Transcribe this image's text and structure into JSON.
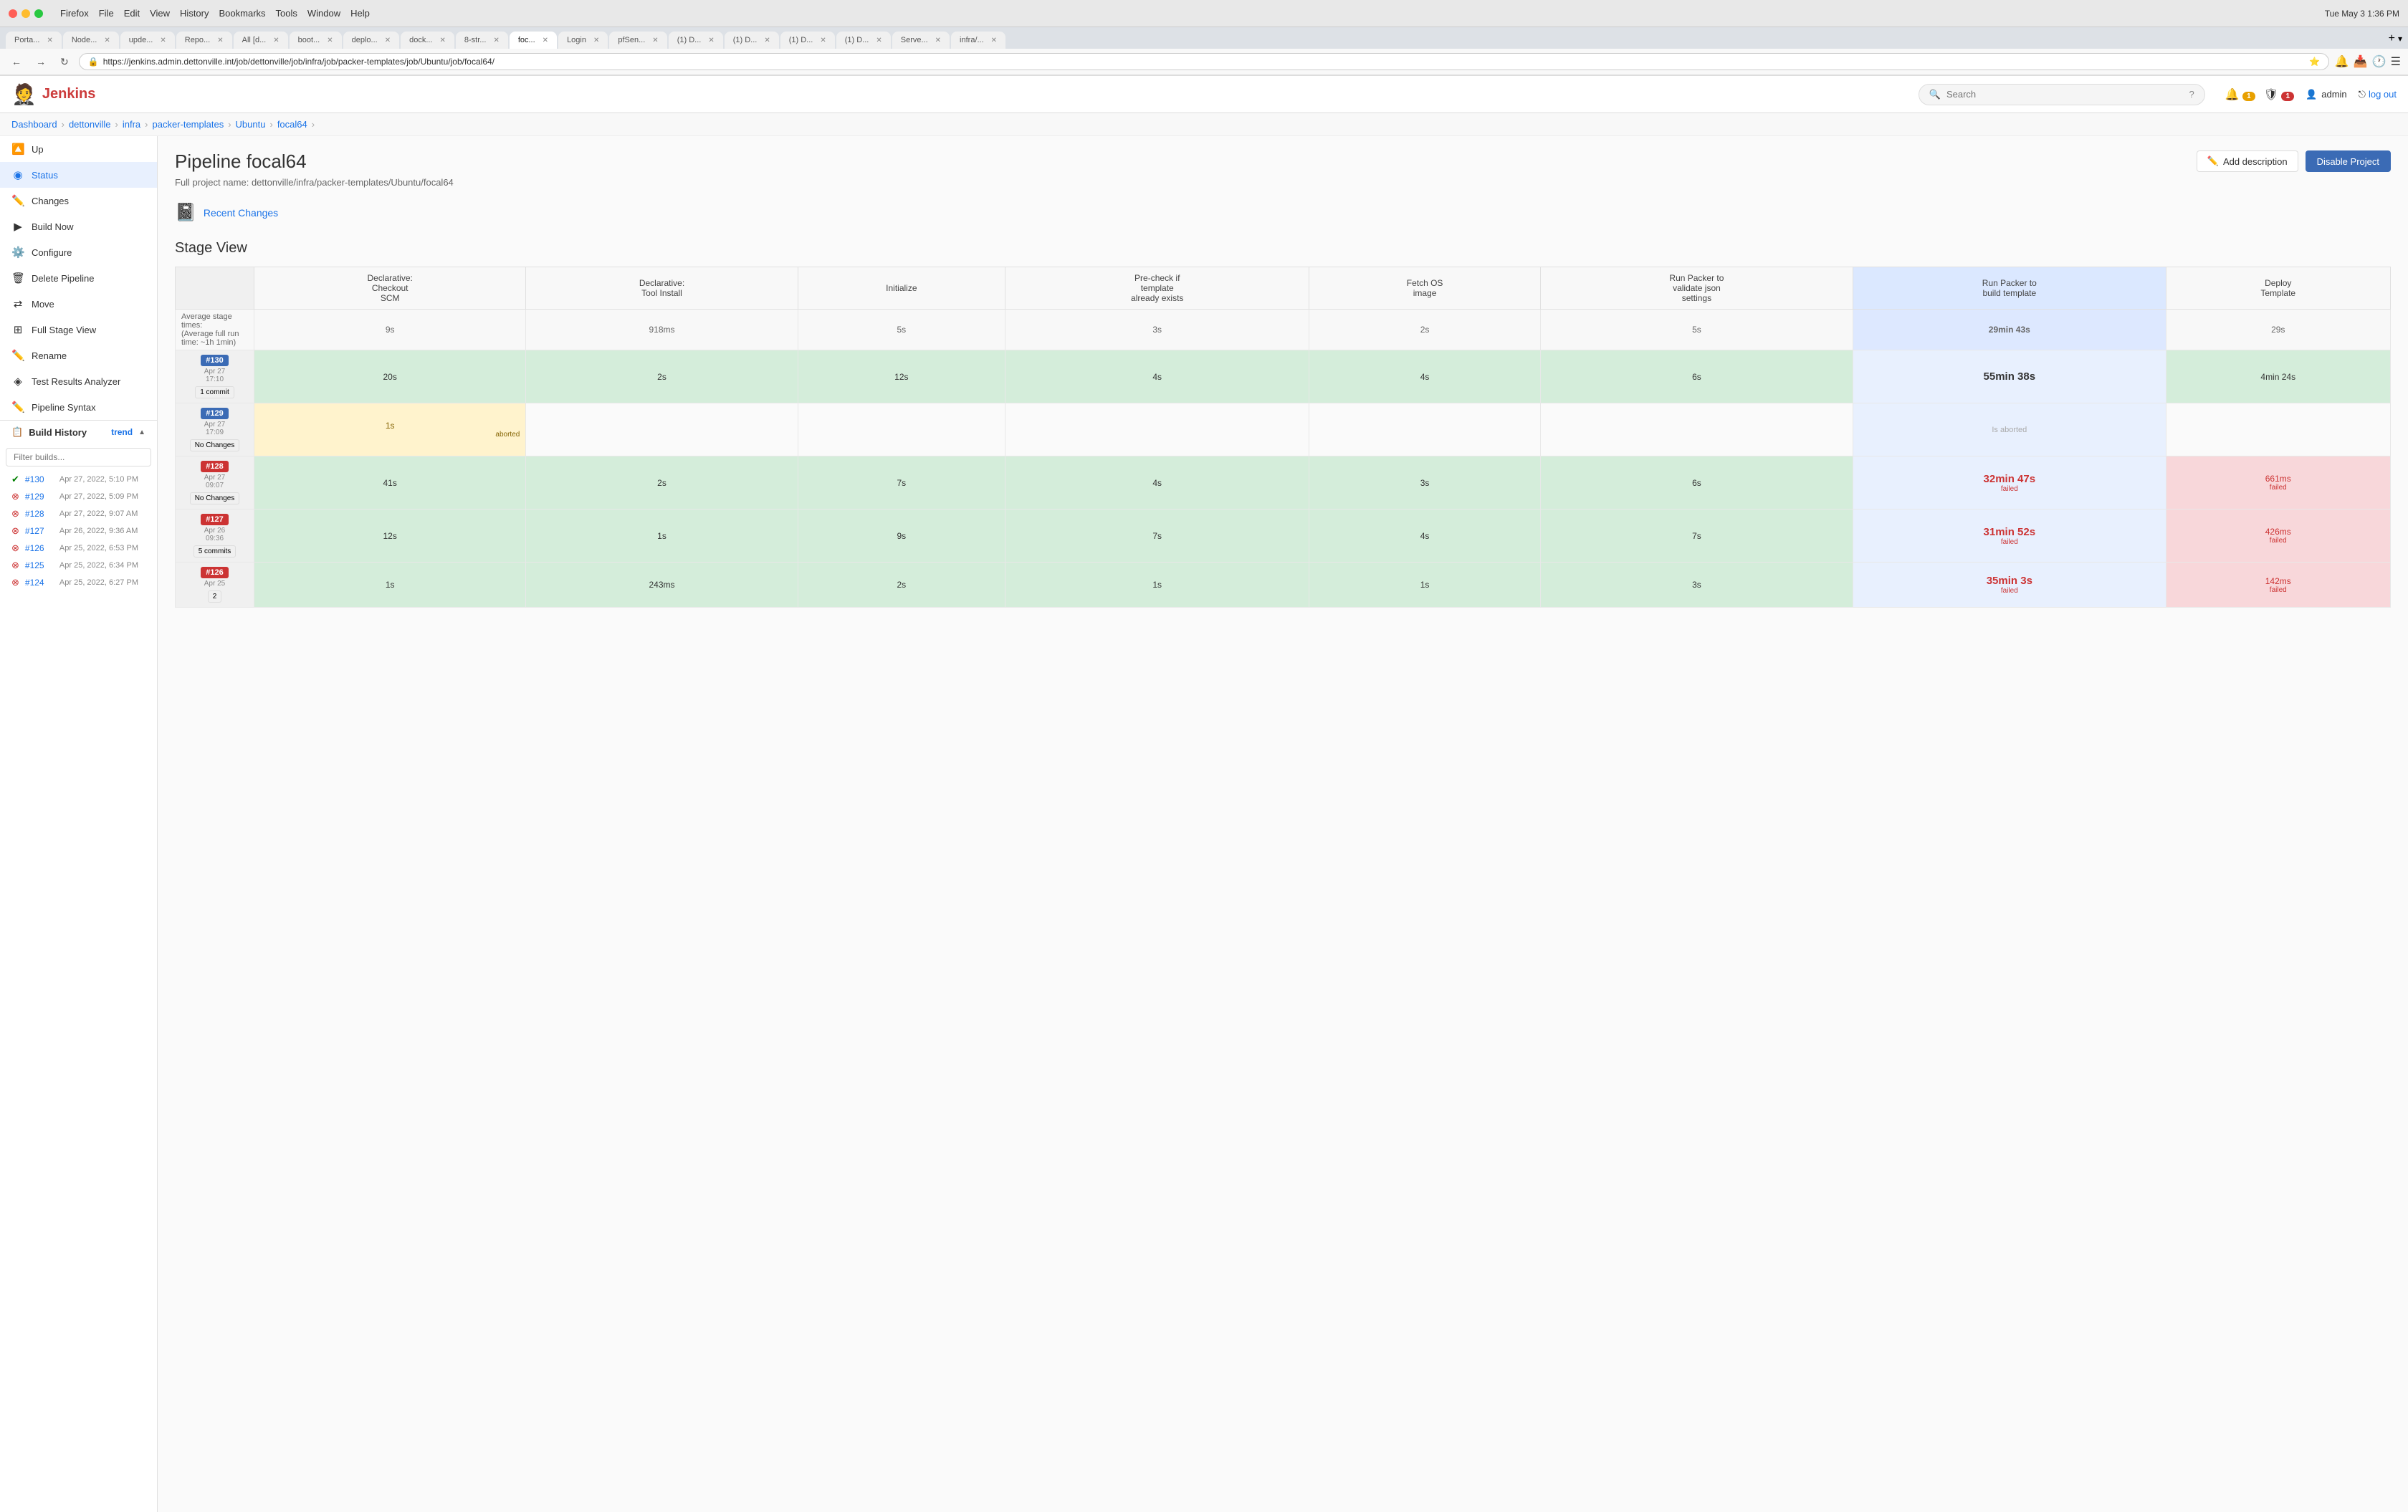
{
  "mac": {
    "time": "Tue May 3  1:36 PM",
    "menu": [
      "Firefox",
      "File",
      "Edit",
      "View",
      "History",
      "Bookmarks",
      "Tools",
      "Window",
      "Help"
    ]
  },
  "browser": {
    "tabs": [
      {
        "label": "Porta...",
        "active": false
      },
      {
        "label": "Node...",
        "active": false
      },
      {
        "label": "upde...",
        "active": false
      },
      {
        "label": "Repo...",
        "active": false
      },
      {
        "label": "All [d...",
        "active": false
      },
      {
        "label": "boot...",
        "active": false
      },
      {
        "label": "deplo...",
        "active": false
      },
      {
        "label": "dock...",
        "active": false
      },
      {
        "label": "8-str...",
        "active": false
      },
      {
        "label": "foc...",
        "active": true
      },
      {
        "label": "Login",
        "active": false
      },
      {
        "label": "pfSen...",
        "active": false
      },
      {
        "label": "(1) D...",
        "active": false
      },
      {
        "label": "(1) D...",
        "active": false
      },
      {
        "label": "(1) D...",
        "active": false
      },
      {
        "label": "(1) D...",
        "active": false
      },
      {
        "label": "Serve...",
        "active": false
      },
      {
        "label": "infra/...",
        "active": false
      }
    ],
    "url": "https://jenkins.admin.dettonville.int/job/dettonville/job/infra/job/packer-templates/job/Ubuntu/job/focal64/"
  },
  "header": {
    "title": "Jenkins",
    "search_placeholder": "Search",
    "user": "admin",
    "logout_label": "log out",
    "notification_count": "1",
    "alert_count": "1"
  },
  "breadcrumb": {
    "items": [
      "Dashboard",
      "dettonville",
      "infra",
      "packer-templates",
      "Ubuntu",
      "focal64"
    ]
  },
  "sidebar": {
    "items": [
      {
        "label": "Up",
        "icon": "↑",
        "active": false
      },
      {
        "label": "Status",
        "icon": "◉",
        "active": true
      },
      {
        "label": "Changes",
        "icon": "✎",
        "active": false
      },
      {
        "label": "Build Now",
        "icon": "▶",
        "active": false
      },
      {
        "label": "Configure",
        "icon": "⚙",
        "active": false
      },
      {
        "label": "Delete Pipeline",
        "icon": "✕",
        "active": false
      },
      {
        "label": "Move",
        "icon": "⇄",
        "active": false
      },
      {
        "label": "Full Stage View",
        "icon": "⊞",
        "active": false
      },
      {
        "label": "Rename",
        "icon": "✎",
        "active": false
      },
      {
        "label": "Test Results Analyzer",
        "icon": "◈",
        "active": false
      },
      {
        "label": "Pipeline Syntax",
        "icon": "✎",
        "active": false
      }
    ],
    "build_history": {
      "label": "Build History",
      "trend_label": "trend",
      "filter_placeholder": "Filter builds...",
      "builds": [
        {
          "id": "#130",
          "date": "Apr 27, 2022, 5:10 PM",
          "status": "success"
        },
        {
          "id": "#129",
          "date": "Apr 27, 2022, 5:09 PM",
          "status": "aborted"
        },
        {
          "id": "#128",
          "date": "Apr 27, 2022, 9:07 AM",
          "status": "failed"
        },
        {
          "id": "#127",
          "date": "Apr 26, 2022, 9:36 AM",
          "status": "failed"
        },
        {
          "id": "#126",
          "date": "Apr 25, 2022, 6:53 PM",
          "status": "failed"
        },
        {
          "id": "#125",
          "date": "Apr 25, 2022, 6:34 PM",
          "status": "failed"
        },
        {
          "id": "#124",
          "date": "Apr 25, 2022, 6:27 PM",
          "status": "failed"
        }
      ]
    }
  },
  "content": {
    "title": "Pipeline focal64",
    "full_project_name_label": "Full project name:",
    "full_project_name": "dettonville/infra/packer-templates/Ubuntu/focal64",
    "add_description_label": "Add description",
    "disable_project_label": "Disable Project",
    "recent_changes_label": "Recent Changes",
    "stage_view_title": "Stage View"
  },
  "stage_view": {
    "columns": [
      {
        "label": "Declarative: Checkout SCM"
      },
      {
        "label": "Declarative: Tool Install"
      },
      {
        "label": "Initialize"
      },
      {
        "label": "Pre-check if template already exists"
      },
      {
        "label": "Fetch OS image"
      },
      {
        "label": "Run Packer to validate json settings"
      },
      {
        "label": "Run Packer to build template"
      },
      {
        "label": "Deploy Template"
      }
    ],
    "avg_times": [
      "9s",
      "918ms",
      "5s",
      "3s",
      "2s",
      "5s",
      "29min 43s",
      "29s"
    ],
    "avg_label": "Average stage times:",
    "avg_run_label": "(Average full run time: ~1h 1min)",
    "builds": [
      {
        "id": "#130",
        "badge_color": "blue",
        "date": "Apr 27",
        "time": "17:10",
        "commits": "1 commit",
        "stages": [
          {
            "value": "20s",
            "type": "green"
          },
          {
            "value": "2s",
            "type": "green"
          },
          {
            "value": "12s",
            "type": "green"
          },
          {
            "value": "4s",
            "type": "green"
          },
          {
            "value": "4s",
            "type": "green"
          },
          {
            "value": "6s",
            "type": "green"
          },
          {
            "value": "55min 38s",
            "type": "green",
            "large": true
          },
          {
            "value": "4min 24s",
            "type": "green"
          }
        ]
      },
      {
        "id": "#129",
        "badge_color": "blue",
        "date": "Apr 27",
        "time": "17:09",
        "commits": "No Changes",
        "stages": [
          {
            "value": "1s",
            "type": "abort"
          },
          {
            "value": "",
            "type": "empty"
          },
          {
            "value": "",
            "type": "empty"
          },
          {
            "value": "",
            "type": "empty"
          },
          {
            "value": "",
            "type": "empty"
          },
          {
            "value": "",
            "type": "empty"
          },
          {
            "value": "",
            "type": "empty"
          },
          {
            "value": "",
            "type": "empty"
          }
        ],
        "aborted": true
      },
      {
        "id": "#128",
        "badge_color": "red",
        "date": "Apr 27",
        "time": "09:07",
        "commits": "No Changes",
        "stages": [
          {
            "value": "41s",
            "type": "green"
          },
          {
            "value": "2s",
            "type": "green"
          },
          {
            "value": "7s",
            "type": "green"
          },
          {
            "value": "4s",
            "type": "green"
          },
          {
            "value": "3s",
            "type": "green"
          },
          {
            "value": "6s",
            "type": "green"
          },
          {
            "value": "32min 47s",
            "type": "red",
            "large": true,
            "failed": true
          },
          {
            "value": "661ms",
            "type": "red",
            "failed": true
          }
        ]
      },
      {
        "id": "#127",
        "badge_color": "red",
        "date": "Apr 26",
        "time": "09:36",
        "commits": "5 commits",
        "stages": [
          {
            "value": "12s",
            "type": "green"
          },
          {
            "value": "1s",
            "type": "green"
          },
          {
            "value": "9s",
            "type": "green"
          },
          {
            "value": "7s",
            "type": "green"
          },
          {
            "value": "4s",
            "type": "green"
          },
          {
            "value": "7s",
            "type": "green"
          },
          {
            "value": "31min 52s",
            "type": "red",
            "large": true,
            "failed": true
          },
          {
            "value": "426ms",
            "type": "red",
            "failed": true
          }
        ]
      },
      {
        "id": "#126",
        "badge_color": "red",
        "date": "Apr 25",
        "time": "",
        "commits": "2",
        "stages": [
          {
            "value": "1s",
            "type": "green"
          },
          {
            "value": "243ms",
            "type": "green"
          },
          {
            "value": "2s",
            "type": "green"
          },
          {
            "value": "1s",
            "type": "green"
          },
          {
            "value": "1s",
            "type": "green"
          },
          {
            "value": "3s",
            "type": "green"
          },
          {
            "value": "35min 3s",
            "type": "red",
            "large": true,
            "failed": true
          },
          {
            "value": "142ms",
            "type": "red",
            "failed": true
          }
        ]
      }
    ]
  }
}
